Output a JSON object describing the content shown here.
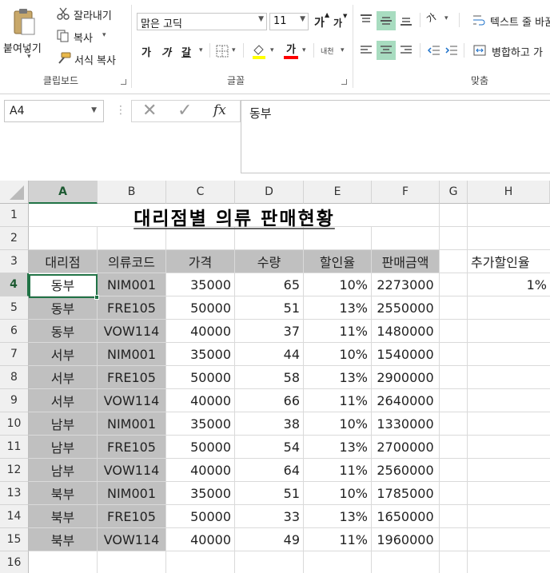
{
  "ribbon": {
    "clipboard": {
      "paste": "붙여넣기",
      "cut": "잘라내기",
      "copy": "복사",
      "format_painter": "서식 복사",
      "group_label": "클립보드"
    },
    "font": {
      "name": "맑은 고딕",
      "size": "11",
      "grow": "가",
      "shrink": "가",
      "bold": "가",
      "italic": "가",
      "underline": "갈",
      "font_color_glyph": "가",
      "phonetic": "내천",
      "group_label": "글꼴",
      "fill_color": "#ffff00",
      "font_color": "#ff0000"
    },
    "alignment": {
      "orientation": "가",
      "wrap_text": "텍스트 줄 바꿈",
      "merge_center": "병합하고 가",
      "group_label": "맞춤"
    }
  },
  "formula_bar": {
    "name_box": "A4",
    "fx": "fx",
    "content": "동부"
  },
  "sheet": {
    "columns": [
      "A",
      "B",
      "C",
      "D",
      "E",
      "F",
      "G",
      "H"
    ],
    "rows": [
      "1",
      "2",
      "3",
      "4",
      "5",
      "6",
      "7",
      "8",
      "9",
      "10",
      "11",
      "12",
      "13",
      "14",
      "15",
      "16"
    ],
    "title": "대리점별 의류 판매현황",
    "headers": [
      "대리점",
      "의류코드",
      "가격",
      "수량",
      "할인율",
      "판매금액"
    ],
    "extra_header": "추가할인율",
    "extra_value": "1%",
    "data": [
      [
        "동부",
        "NIM001",
        "35000",
        "65",
        "10%",
        "2273000"
      ],
      [
        "동부",
        "FRE105",
        "50000",
        "51",
        "13%",
        "2550000"
      ],
      [
        "동부",
        "VOW114",
        "40000",
        "37",
        "11%",
        "1480000"
      ],
      [
        "서부",
        "NIM001",
        "35000",
        "44",
        "10%",
        "1540000"
      ],
      [
        "서부",
        "FRE105",
        "50000",
        "58",
        "13%",
        "2900000"
      ],
      [
        "서부",
        "VOW114",
        "40000",
        "66",
        "11%",
        "2640000"
      ],
      [
        "남부",
        "NIM001",
        "35000",
        "38",
        "10%",
        "1330000"
      ],
      [
        "남부",
        "FRE105",
        "50000",
        "54",
        "13%",
        "2700000"
      ],
      [
        "남부",
        "VOW114",
        "40000",
        "64",
        "11%",
        "2560000"
      ],
      [
        "북부",
        "NIM001",
        "35000",
        "51",
        "10%",
        "1785000"
      ],
      [
        "북부",
        "FRE105",
        "50000",
        "33",
        "13%",
        "1650000"
      ],
      [
        "북부",
        "VOW114",
        "40000",
        "49",
        "11%",
        "1960000"
      ]
    ]
  }
}
